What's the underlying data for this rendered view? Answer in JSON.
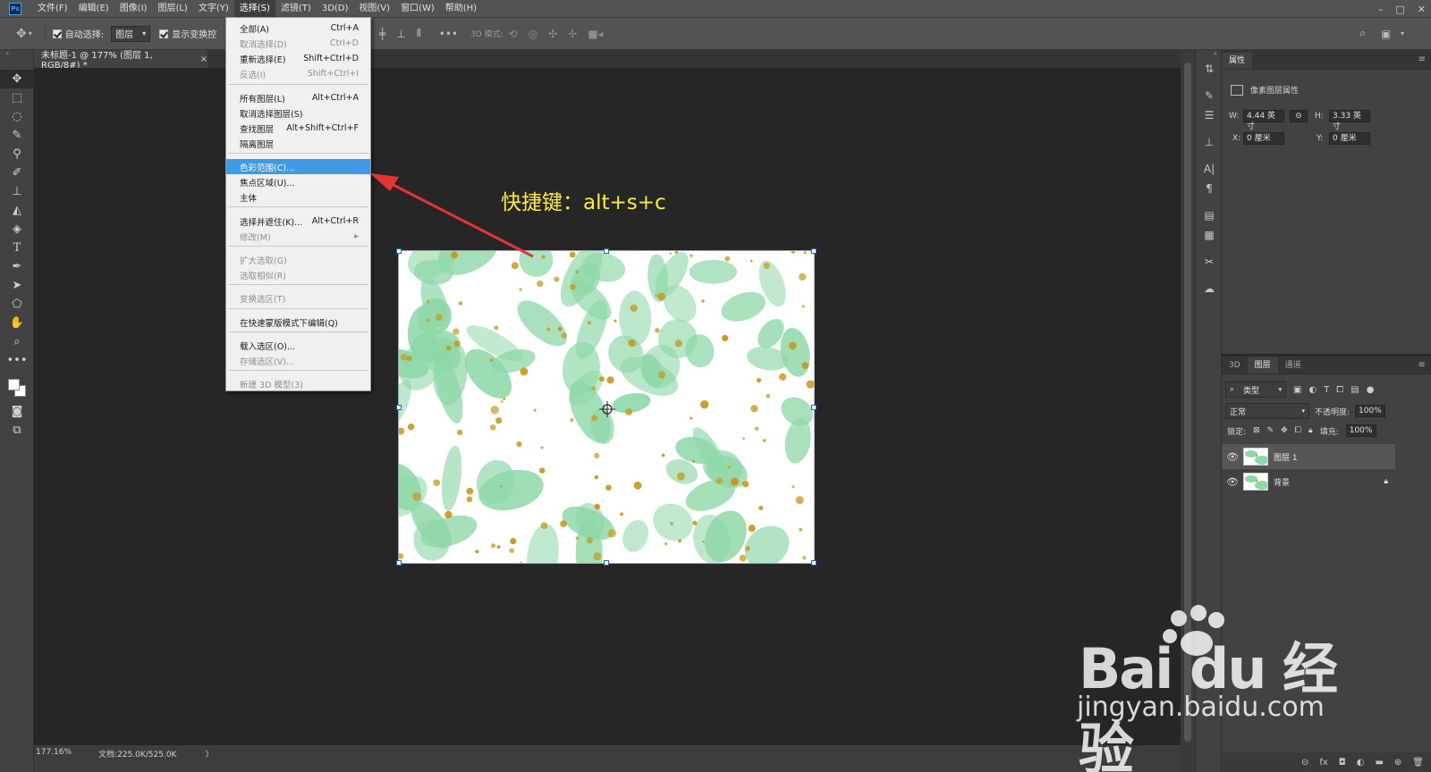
{
  "app": {
    "logo": "Ps"
  },
  "menubar": {
    "items": [
      "文件(F)",
      "编辑(E)",
      "图像(I)",
      "图层(L)",
      "文字(Y)",
      "选择(S)",
      "滤镜(T)",
      "3D(D)",
      "视图(V)",
      "窗口(W)",
      "帮助(H)"
    ],
    "active_index": 5
  },
  "options": {
    "auto_select_label": "自动选择:",
    "auto_select_value": "图层",
    "show_transform_label": "显示变换控",
    "mode_3d_label": "3D 模式:"
  },
  "document": {
    "tab_title": "未标题-1 @ 177% (图层 1, RGB/8#) *",
    "close": "×"
  },
  "status": {
    "zoom": "177.16%",
    "doc_size": "文档:225.0K/525.0K",
    "arrow": "〉"
  },
  "select_menu": {
    "items": [
      {
        "label": "全部(A)",
        "shortcut": "Ctrl+A",
        "disabled": false
      },
      {
        "label": "取消选择(D)",
        "shortcut": "Ctrl+D",
        "disabled": true
      },
      {
        "label": "重新选择(E)",
        "shortcut": "Shift+Ctrl+D",
        "disabled": false
      },
      {
        "label": "反选(I)",
        "shortcut": "Shift+Ctrl+I",
        "disabled": true
      },
      {
        "label": "所有图层(L)",
        "shortcut": "Alt+Ctrl+A",
        "disabled": false
      },
      {
        "label": "取消选择图层(S)",
        "shortcut": "",
        "disabled": false
      },
      {
        "label": "查找图层",
        "shortcut": "Alt+Shift+Ctrl+F",
        "disabled": false
      },
      {
        "label": "隔离图层",
        "shortcut": "",
        "disabled": false
      },
      {
        "label": "色彩范围(C)...",
        "shortcut": "",
        "disabled": false,
        "highlighted": true
      },
      {
        "label": "焦点区域(U)...",
        "shortcut": "",
        "disabled": false
      },
      {
        "label": "主体",
        "shortcut": "",
        "disabled": false
      },
      {
        "label": "选择并遮住(K)...",
        "shortcut": "Alt+Ctrl+R",
        "disabled": false
      },
      {
        "label": "修改(M)",
        "shortcut": "▸",
        "disabled": true
      },
      {
        "label": "扩大选取(G)",
        "shortcut": "",
        "disabled": true
      },
      {
        "label": "选取相似(R)",
        "shortcut": "",
        "disabled": true
      },
      {
        "label": "变换选区(T)",
        "shortcut": "",
        "disabled": true
      },
      {
        "label": "在快速蒙版模式下编辑(Q)",
        "shortcut": "",
        "disabled": false
      },
      {
        "label": "载入选区(O)...",
        "shortcut": "",
        "disabled": false
      },
      {
        "label": "存储选区(V)...",
        "shortcut": "",
        "disabled": true
      },
      {
        "label": "新建 3D 模型(3)",
        "shortcut": "",
        "disabled": true
      }
    ]
  },
  "annotation": {
    "text": "快捷键：alt+s+c",
    "color": "#ffeb3b"
  },
  "properties": {
    "tab": "属性",
    "header": "像素图层属性",
    "w_label": "W:",
    "w_value": "4.44 英寸",
    "h_label": "H:",
    "h_value": "3.33 英寸",
    "x_label": "X:",
    "x_value": "0 厘米",
    "y_label": "Y:",
    "y_value": "0 厘米",
    "link_icon": "⊝"
  },
  "layers_panel": {
    "tabs": [
      "3D",
      "图层",
      "通道"
    ],
    "active_tab": "图层",
    "filter_value": "类型",
    "blend_mode": "正常",
    "opacity_label": "不透明度:",
    "opacity_value": "100%",
    "lock_label": "锁定:",
    "fill_label": "填充:",
    "fill_value": "100%",
    "layers": [
      {
        "name": "图层 1",
        "selected": true,
        "locked": false
      },
      {
        "name": "背景",
        "selected": false,
        "locked": true
      }
    ]
  },
  "watermark": {
    "logo": "Bai du 经验",
    "url": "jingyan.baidu.com"
  },
  "colors": {
    "accent": "#3f9ae6",
    "arrow": "#e63434",
    "leaf": "#8ed8a8",
    "spot": "#c89a1e"
  }
}
